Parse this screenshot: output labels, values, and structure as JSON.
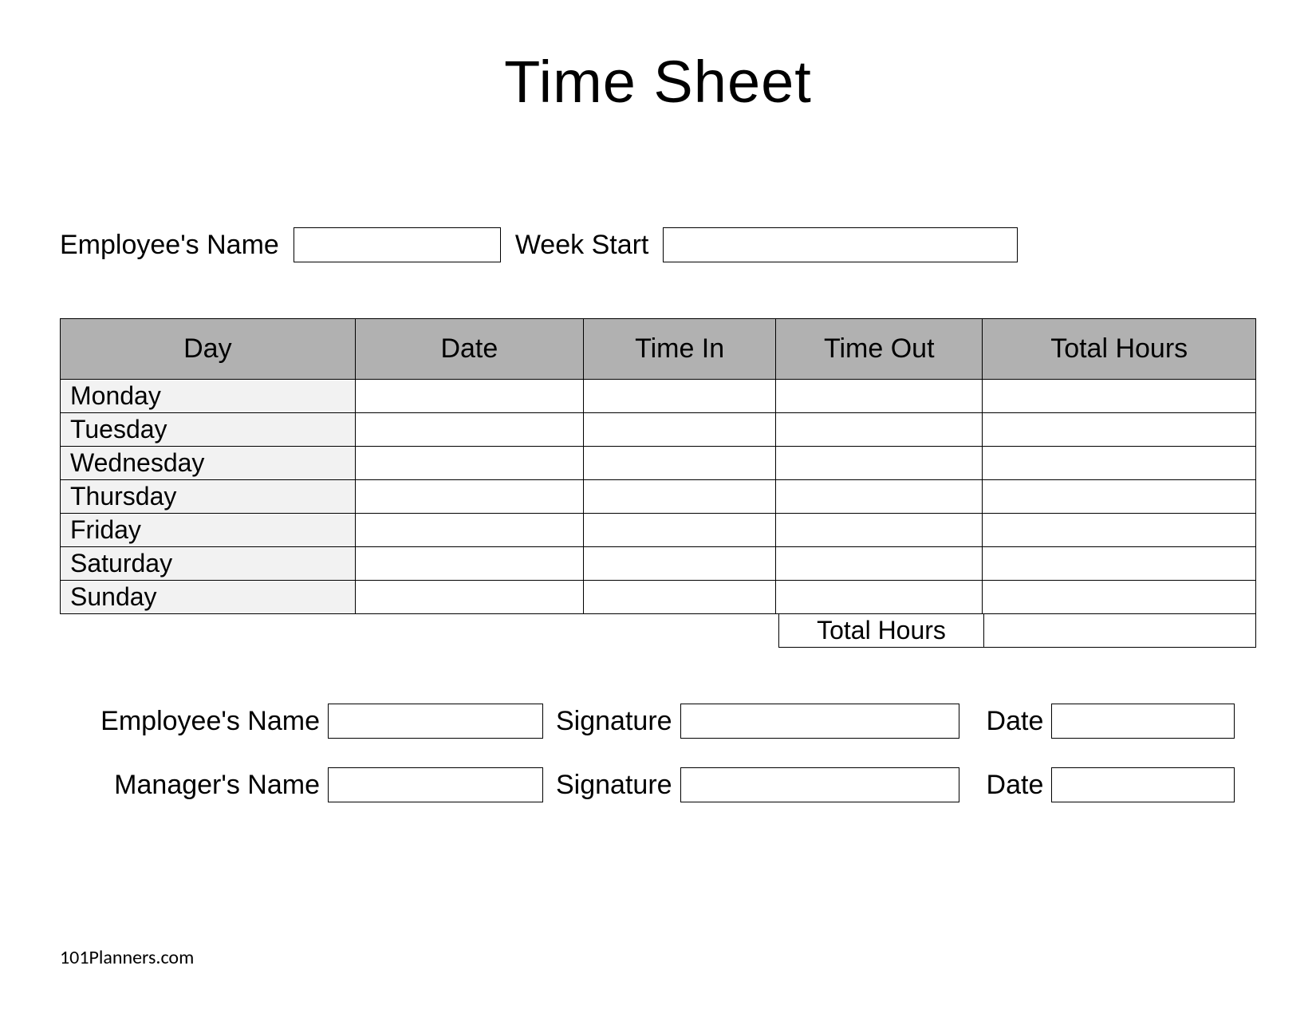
{
  "title": "Time Sheet",
  "header": {
    "employee_label": "Employee's Name",
    "employee_value": "",
    "week_start_label": "Week Start",
    "week_start_value": ""
  },
  "table": {
    "columns": {
      "day": "Day",
      "date": "Date",
      "time_in": "Time In",
      "time_out": "Time Out",
      "total_hours": "Total Hours"
    },
    "rows": [
      {
        "day": "Monday",
        "date": "",
        "time_in": "",
        "time_out": "",
        "total": ""
      },
      {
        "day": "Tuesday",
        "date": "",
        "time_in": "",
        "time_out": "",
        "total": ""
      },
      {
        "day": "Wednesday",
        "date": "",
        "time_in": "",
        "time_out": "",
        "total": ""
      },
      {
        "day": "Thursday",
        "date": "",
        "time_in": "",
        "time_out": "",
        "total": ""
      },
      {
        "day": "Friday",
        "date": "",
        "time_in": "",
        "time_out": "",
        "total": ""
      },
      {
        "day": "Saturday",
        "date": "",
        "time_in": "",
        "time_out": "",
        "total": ""
      },
      {
        "day": "Sunday",
        "date": "",
        "time_in": "",
        "time_out": "",
        "total": ""
      }
    ],
    "total_label": "Total Hours",
    "total_value": ""
  },
  "signatures": {
    "employee": {
      "name_label": "Employee's Name",
      "name_value": "",
      "signature_label": "Signature",
      "signature_value": "",
      "date_label": "Date",
      "date_value": ""
    },
    "manager": {
      "name_label": "Manager's Name",
      "name_value": "",
      "signature_label": "Signature",
      "signature_value": "",
      "date_label": "Date",
      "date_value": ""
    }
  },
  "footer": "101Planners.com"
}
